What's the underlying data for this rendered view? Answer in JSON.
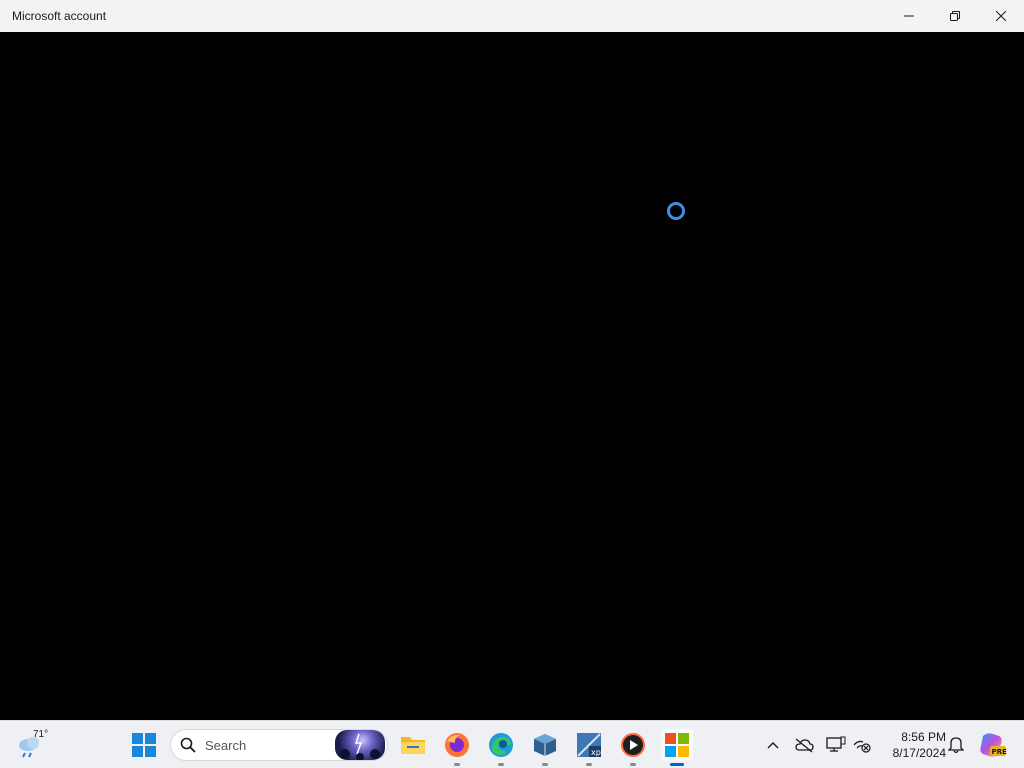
{
  "window": {
    "title": "Microsoft account",
    "minimize_icon": "minimize-icon",
    "restore_icon": "restore-icon",
    "close_icon": "close-icon"
  },
  "content": {
    "state": "loading",
    "spinner_color": "#3a8fe0",
    "background": "#000000"
  },
  "taskbar": {
    "weather": {
      "temperature": "71°",
      "icon": "weather-rain-icon"
    },
    "start_icon": "windows-start-icon",
    "search": {
      "label": "Search"
    },
    "apps": [
      {
        "name": "File Explorer",
        "icon": "folder-icon",
        "running": false
      },
      {
        "name": "Firefox",
        "icon": "firefox-icon",
        "running": true
      },
      {
        "name": "Microsoft Edge",
        "icon": "edge-icon",
        "running": true
      },
      {
        "name": "VirtualBox",
        "icon": "virtualbox-icon",
        "running": true
      },
      {
        "name": "VirtualBox XP",
        "icon": "xp-vm-icon",
        "running": true
      },
      {
        "name": "Media Player",
        "icon": "media-player-icon",
        "running": true
      },
      {
        "name": "Microsoft Store",
        "icon": "microsoft-logo-icon",
        "running": true,
        "active": true
      }
    ],
    "tray": {
      "chevron_icon": "chevron-up-icon",
      "onedrive_icon": "onedrive-offline-icon",
      "display_icon": "display-icon",
      "network_icon": "network-disconnected-icon"
    },
    "clock": {
      "time": "8:56 PM",
      "date": "8/17/2024"
    },
    "notification_icon": "bell-icon",
    "copilot_icon": "copilot-pre-icon",
    "copilot_badge": "PRE"
  }
}
